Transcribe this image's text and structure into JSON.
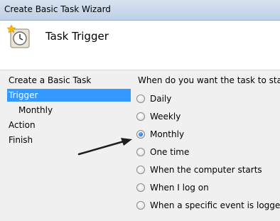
{
  "window": {
    "title": "Create Basic Task Wizard"
  },
  "header": {
    "title": "Task Trigger",
    "icon": "clock-icon"
  },
  "sidebar": {
    "items": [
      {
        "label": "Create a Basic Task"
      },
      {
        "label": "Trigger"
      },
      {
        "label": "Monthly"
      },
      {
        "label": "Action"
      },
      {
        "label": "Finish"
      }
    ],
    "selected_color": "#3399ff"
  },
  "main": {
    "prompt": "When do you want the task to start?",
    "options": [
      {
        "label": "Daily",
        "checked": false
      },
      {
        "label": "Weekly",
        "checked": false
      },
      {
        "label": "Monthly",
        "checked": true
      },
      {
        "label": "One time",
        "checked": false
      },
      {
        "label": "When the computer starts",
        "checked": false
      },
      {
        "label": "When I log on",
        "checked": false
      },
      {
        "label": "When a specific event is logged",
        "checked": false
      }
    ]
  },
  "annotation": {
    "icon": "arrow-icon"
  }
}
